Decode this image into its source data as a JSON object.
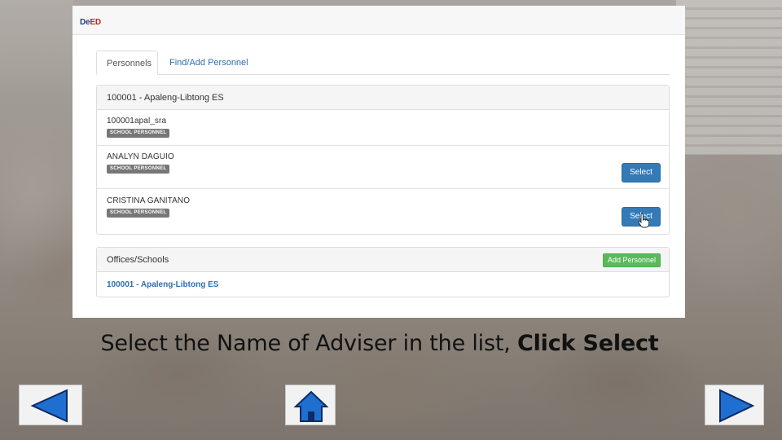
{
  "logo": {
    "prefix": "De",
    "suffix": "ED"
  },
  "tabs": {
    "active": "Personnels",
    "link": "Find/Add Personnel"
  },
  "school_panel": {
    "heading": "100001 - Apaleng-Libtong ES",
    "personnel": [
      {
        "name": "100001apal_sra",
        "role": "SCHOOL PERSONNEL"
      },
      {
        "name": "ANALYN DAGUIO",
        "role": "SCHOOL PERSONNEL",
        "button": "Select"
      },
      {
        "name": "CRISTINA GANITANO",
        "role": "SCHOOL PERSONNEL",
        "button": "Select"
      }
    ]
  },
  "offices_panel": {
    "heading": "Offices/Schools",
    "add_button": "Add Personnel",
    "school_link": "100001 - Apaleng-Libtong ES"
  },
  "caption": {
    "text": "Select the Name of Adviser in the list, ",
    "bold": "Click Select"
  },
  "nav": {
    "prev": "prev-arrow-icon",
    "home": "home-icon",
    "next": "next-arrow-icon"
  },
  "colors": {
    "primary_button": "#337ab7",
    "success_button": "#5cb85c",
    "badge": "#777777",
    "link": "#2f6fb3",
    "nav_fill": "#1f6fd0"
  }
}
